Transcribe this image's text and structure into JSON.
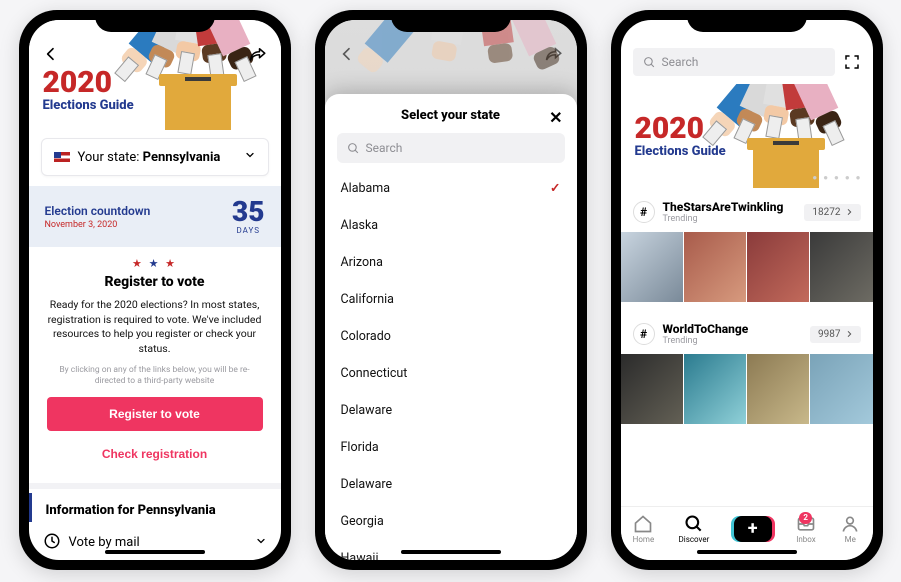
{
  "guide": {
    "year": "2020",
    "subtitle": "Elections Guide",
    "state_label_prefix": "Your state: ",
    "state_name": "Pennsylvania",
    "countdown_title": "Election countdown",
    "countdown_date": "November 3, 2020",
    "countdown_number": "35",
    "countdown_unit": "DAYS",
    "register_heading": "Register to vote",
    "register_desc": "Ready for the 2020 elections? In most states, registration is required to vote. We've included resources to help you register or check your status.",
    "register_fineprint": "By clicking on any of the links below, you will be re-directed to a third-party website",
    "btn_register": "Register to vote",
    "btn_check": "Check registration",
    "info_title": "Information for Pennsylvania",
    "vote_by_mail": "Vote by mail"
  },
  "picker": {
    "title": "Select your state",
    "search_placeholder": "Search",
    "selected": "Alabama",
    "states": [
      "Alabama",
      "Alaska",
      "Arizona",
      "California",
      "Colorado",
      "Connecticut",
      "Delaware",
      "Florida",
      "Delaware",
      "Georgia",
      "Hawaii"
    ]
  },
  "discover": {
    "search_placeholder": "Search",
    "trends": [
      {
        "name": "TheStarsAreTwinkling",
        "sub": "Trending",
        "count": "18272"
      },
      {
        "name": "WorldToChange",
        "sub": "Trending",
        "count": "9987"
      }
    ],
    "nav": {
      "home": "Home",
      "discover": "Discover",
      "inbox": "Inbox",
      "me": "Me",
      "inbox_badge": "2"
    }
  }
}
